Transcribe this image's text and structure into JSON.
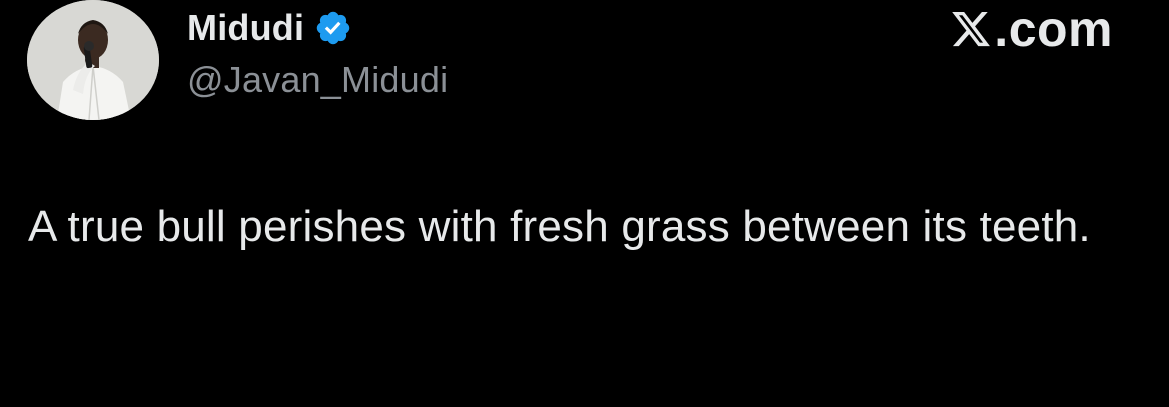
{
  "author": {
    "display_name": "Midudi",
    "handle": "@Javan_Midudi",
    "verified": true,
    "avatar_icon": "profile-photo"
  },
  "brand": {
    "label": ".com",
    "logo_icon": "x-logo-icon"
  },
  "tweet": {
    "text": "A true bull perishes with fresh grass between its teeth."
  },
  "colors": {
    "background": "#000000",
    "text": "#e7e9ea",
    "secondary_text": "#8b9096",
    "verified_badge": "#1d9bf0"
  }
}
